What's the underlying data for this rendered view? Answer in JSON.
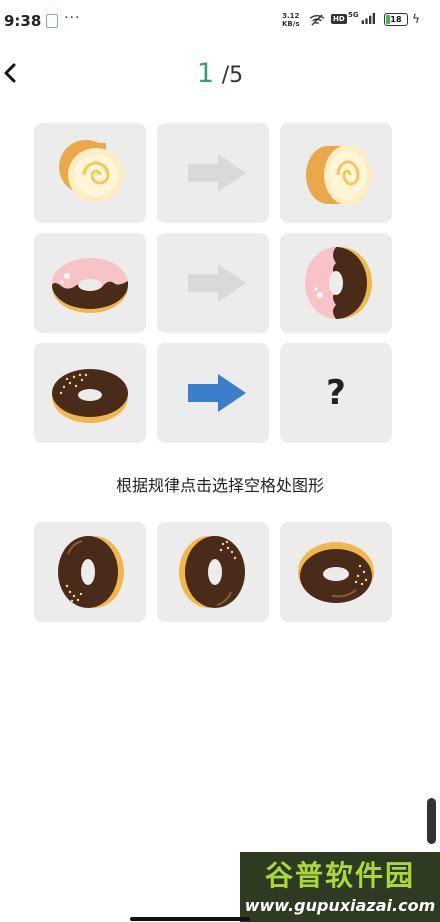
{
  "status_bar": {
    "time": "9:38",
    "net_speed_value": "3.12",
    "net_speed_unit": "KB/s",
    "hd_label": "HD",
    "network_label": "5G",
    "battery_level": "18"
  },
  "header": {
    "current": "1",
    "total": "/5"
  },
  "puzzle": {
    "question_mark": "?",
    "instruction": "根据规律点击选择空格处图形"
  },
  "colors": {
    "accent": "#3a9a84",
    "tile_bg": "#ececec",
    "arrow_inactive": "#d9d9d9",
    "arrow_active": "#3b7fcb"
  },
  "watermark": {
    "name": "谷普软件园",
    "url": "www.gupuxiazai.com"
  }
}
